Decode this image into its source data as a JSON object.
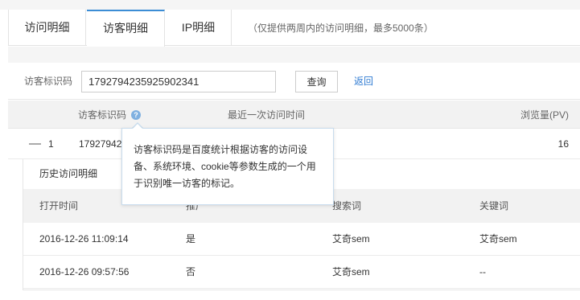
{
  "tabs": [
    {
      "label": "访问明细"
    },
    {
      "label": "访客明细"
    },
    {
      "label": "IP明细"
    }
  ],
  "tab_note": "（仅提供两周内的访问明细，最多5000条）",
  "search": {
    "label": "访客标识码",
    "value": "1792794235925902341",
    "query_button": "查询",
    "back_link": "返回"
  },
  "table": {
    "headers": [
      "访客标识码",
      "最近一次访问时间",
      "浏览量(PV)"
    ],
    "help_icon_glyph": "?",
    "row": {
      "toggle": "—",
      "index": "1",
      "visitor_id_visible": "17927942",
      "pv": "16"
    }
  },
  "detail": {
    "title": "历史访问明细",
    "headers": [
      "打开时间",
      "推广",
      "搜索词",
      "关键词"
    ],
    "rows": [
      {
        "time": "2016-12-26 11:09:14",
        "promo": "是",
        "search_term": "艾奇sem",
        "keyword": "艾奇sem"
      },
      {
        "time": "2016-12-26 09:57:56",
        "promo": "否",
        "search_term": "艾奇sem",
        "keyword": "--"
      }
    ]
  },
  "tooltip": {
    "text": "访客标识码是百度统计根据访客的访问设备、系统环境、cookie等参数生成的一个用于识别唯一访客的标记。"
  },
  "colors": {
    "active_tab_border": "#3c8dd5",
    "link": "#2f7bd2",
    "help_icon": "#7fb0e0"
  }
}
